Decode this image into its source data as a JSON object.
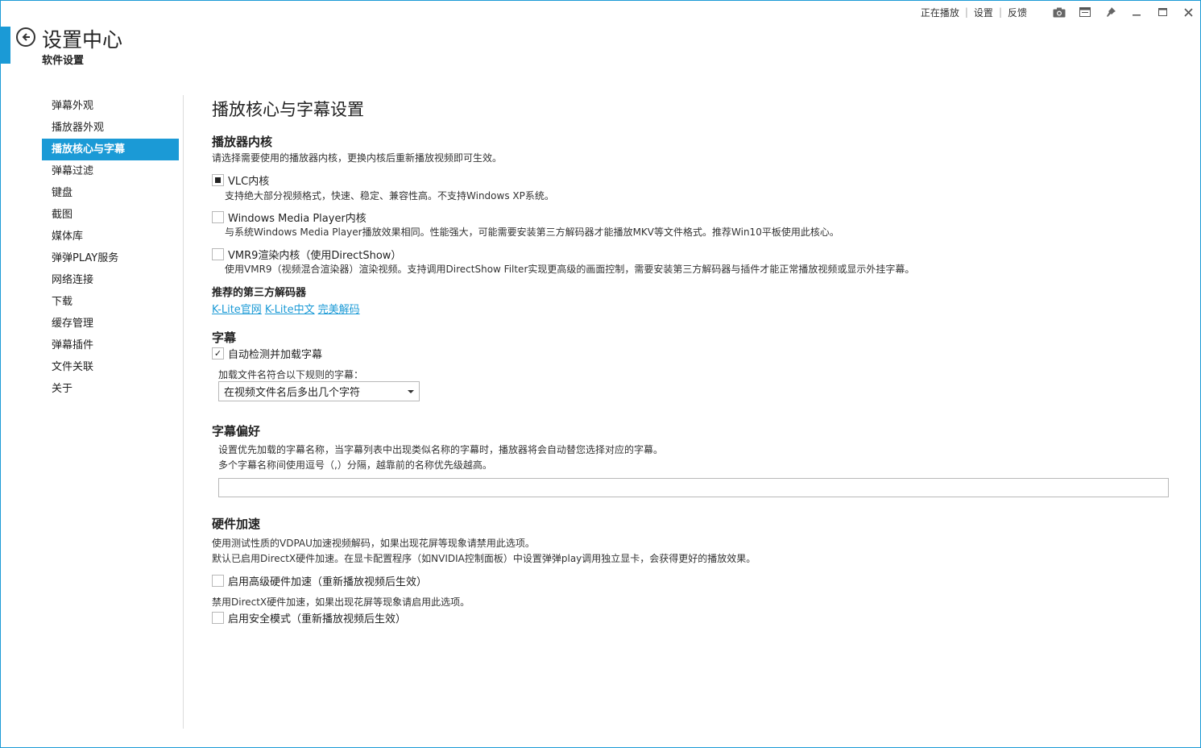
{
  "topbar": {
    "links": [
      "正在播放",
      "设置",
      "反馈"
    ],
    "icons": [
      "camera-icon",
      "window-mode-icon",
      "pin-icon",
      "minimize-icon",
      "maximize-icon",
      "close-icon"
    ]
  },
  "header": {
    "title": "设置中心",
    "subtitle": "软件设置"
  },
  "sidebar": {
    "items": [
      {
        "label": "弹幕外观",
        "active": false
      },
      {
        "label": "播放器外观",
        "active": false
      },
      {
        "label": "播放核心与字幕",
        "active": true
      },
      {
        "label": "弹幕过滤",
        "active": false
      },
      {
        "label": "键盘",
        "active": false
      },
      {
        "label": "截图",
        "active": false
      },
      {
        "label": "媒体库",
        "active": false
      },
      {
        "label": "弹弹PLAY服务",
        "active": false
      },
      {
        "label": "网络连接",
        "active": false
      },
      {
        "label": "下载",
        "active": false
      },
      {
        "label": "缓存管理",
        "active": false
      },
      {
        "label": "弹幕插件",
        "active": false
      },
      {
        "label": "文件关联",
        "active": false
      },
      {
        "label": "关于",
        "active": false
      }
    ]
  },
  "main": {
    "page_title": "播放核心与字幕设置",
    "core": {
      "heading": "播放器内核",
      "desc": "请选择需要使用的播放器内核，更换内核后重新播放视频即可生效。",
      "options": [
        {
          "label": "VLC内核",
          "checked": true,
          "desc": "支持绝大部分视频格式，快速、稳定、兼容性高。不支持Windows XP系统。"
        },
        {
          "label": "Windows Media Player内核",
          "checked": false,
          "desc": "与系统Windows Media Player播放效果相同。性能强大，可能需要安装第三方解码器才能播放MKV等文件格式。推荐Win10平板使用此核心。"
        },
        {
          "label": "VMR9渲染内核（使用DirectShow）",
          "checked": false,
          "desc": "使用VMR9（视频混合渲染器）渲染视频。支持调用DirectShow Filter实现更高级的画面控制，需要安装第三方解码器与插件才能正常播放视频或显示外挂字幕。"
        }
      ],
      "decoders_heading": "推荐的第三方解码器",
      "decoder_links": [
        "K-Lite官网",
        "K-Lite中文",
        "完美解码"
      ]
    },
    "subtitle": {
      "heading": "字幕",
      "auto_load_label": "自动检测并加载字幕",
      "auto_load_checked": true,
      "rule_label": "加载文件名符合以下规则的字幕：",
      "rule_selected": "在视频文件名后多出几个字符"
    },
    "subtitle_pref": {
      "heading": "字幕偏好",
      "desc1": "设置优先加载的字幕名称，当字幕列表中出现类似名称的字幕时，播放器将会自动替您选择对应的字幕。",
      "desc2": "多个字幕名称间使用逗号（,）分隔，越靠前的名称优先级越高。",
      "value": ""
    },
    "hw": {
      "heading": "硬件加速",
      "desc1": "使用测试性质的VDPAU加速视频解码，如果出现花屏等现象请禁用此选项。",
      "desc2": "默认已启用DirectX硬件加速。在显卡配置程序（如NVIDIA控制面板）中设置弹弹play调用独立显卡，会获得更好的播放效果。",
      "adv_label": "启用高级硬件加速（重新播放视频后生效）",
      "adv_checked": false,
      "desc3": "禁用DirectX硬件加速，如果出现花屏等现象请启用此选项。",
      "safe_label": "启用安全模式（重新播放视频后生效）",
      "safe_checked": false
    }
  },
  "colors": {
    "accent": "#1b9ad6"
  }
}
